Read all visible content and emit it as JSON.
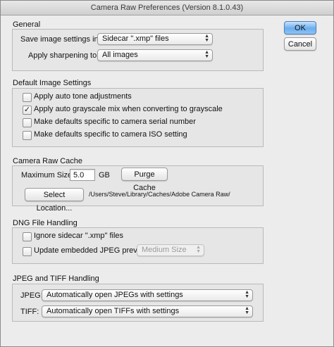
{
  "window": {
    "title": "Camera Raw Preferences  (Version 8.1.0.43)"
  },
  "actions": {
    "ok": "OK",
    "cancel": "Cancel"
  },
  "general": {
    "title": "General",
    "save_label": "Save image settings in:",
    "save_value": "Sidecar \".xmp\" files",
    "sharpen_label": "Apply sharpening to:",
    "sharpen_value": "All images"
  },
  "default_settings": {
    "title": "Default Image Settings",
    "items": [
      {
        "label": "Apply auto tone adjustments",
        "checked": false
      },
      {
        "label": "Apply auto grayscale mix when converting to grayscale",
        "checked": true
      },
      {
        "label": "Make defaults specific to camera serial number",
        "checked": false
      },
      {
        "label": "Make defaults specific to camera ISO setting",
        "checked": false
      }
    ]
  },
  "cache": {
    "title": "Camera Raw Cache",
    "max_size_label": "Maximum Size:",
    "max_size_value": "5.0",
    "unit": "GB",
    "purge_button": "Purge Cache",
    "select_button": "Select Location...",
    "path": "/Users/Steve/Library/Caches/Adobe Camera Raw/"
  },
  "dng": {
    "title": "DNG File Handling",
    "ignore_label": "Ignore sidecar \".xmp\" files",
    "ignore_checked": false,
    "update_label": "Update embedded JPEG previews:",
    "update_checked": false,
    "preview_value": "Medium Size"
  },
  "jpeg_tiff": {
    "title": "JPEG and TIFF Handling",
    "jpeg_label": "JPEG:",
    "jpeg_value": "Automatically open JPEGs with settings",
    "tiff_label": "TIFF:",
    "tiff_value": "Automatically open TIFFs with settings"
  }
}
